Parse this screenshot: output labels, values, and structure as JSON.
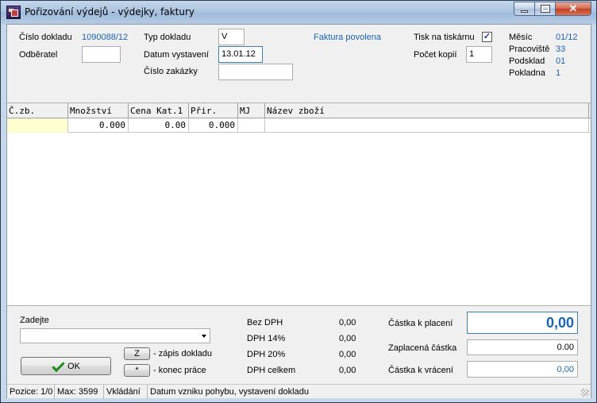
{
  "window": {
    "title": "Pořizování výdejů - výdejky, faktury"
  },
  "header": {
    "cislo_dokladu_label": "Číslo dokladu",
    "cislo_dokladu_value": "1090088/12",
    "odberatel_label": "Odběratel",
    "odberatel_value": "",
    "typ_dokladu_label": "Typ dokladu",
    "typ_dokladu_value": "V",
    "datum_vystaveni_label": "Datum vystavení",
    "datum_vystaveni_value": "13.01.12",
    "cislo_zakazky_label": "Číslo zakázky",
    "cislo_zakazky_value": "",
    "faktura_povolena": "Faktura povolena",
    "tisk_label": "Tisk na tiskárnu",
    "tisk_checked": true,
    "tisk_check_glyph": "✓",
    "pocet_kopii_label": "Počet kopií",
    "pocet_kopii_value": "1",
    "mesic_label": "Měsíc",
    "mesic_value": "01/12",
    "pracoviste_label": "Pracoviště",
    "pracoviste_value": "33",
    "podsklad_label": "Podsklad",
    "podsklad_value": "01",
    "pokladna_label": "Pokladna",
    "pokladna_value": "1"
  },
  "grid": {
    "columns": [
      "Č.zb.",
      "Množství",
      "Cena Kat.1",
      "Přir.",
      "MJ",
      "Název zboží"
    ],
    "rows": [
      [
        "",
        "0.000",
        "0.00",
        "0.000",
        "",
        ""
      ]
    ]
  },
  "footer": {
    "zadejte_label": "Zadejte",
    "combo_value": "",
    "z_key": "Z",
    "z_desc": "- zápis dokladu",
    "star_key": "*",
    "star_desc": "- konec práce",
    "ok_label": "OK",
    "bez_dph_label": "Bez DPH",
    "bez_dph_value": "0,00",
    "dph14_label": "DPH 14%",
    "dph14_value": "0,00",
    "dph20_label": "DPH 20%",
    "dph20_value": "0,00",
    "dph_celkem_label": "DPH celkem",
    "dph_celkem_value": "0,00",
    "castka_k_placeni_label": "Částka k placení",
    "castka_k_placeni_value": "0,00",
    "zaplacena_castka_label": "Zaplacená částka",
    "zaplacena_castka_value": "0.00",
    "castka_k_vraceni_label": "Částka k vrácení",
    "castka_k_vraceni_value": "0,00"
  },
  "status": {
    "pozice": "Pozice: 1/0",
    "max": "Max: 3599",
    "mode": "Vkládání",
    "hint": "Datum vzniku pohybu, vystavení dokladu"
  },
  "colors": {
    "accent_blue": "#1a64b4",
    "active_cell": "#ffffd0"
  }
}
